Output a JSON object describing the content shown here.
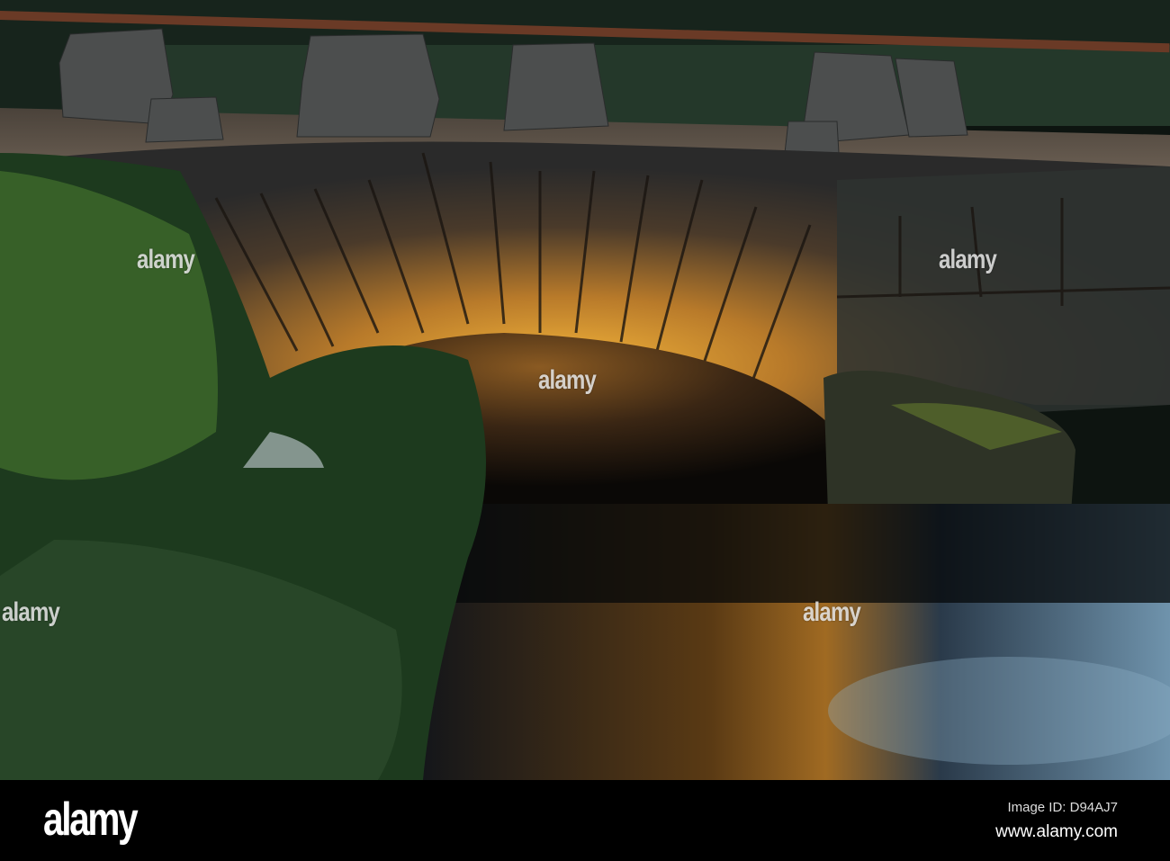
{
  "photo": {
    "watermark": "alamy"
  },
  "footer": {
    "logo": "alamy",
    "image_id": "Image ID: D94AJ7",
    "website": "www.alamy.com"
  }
}
